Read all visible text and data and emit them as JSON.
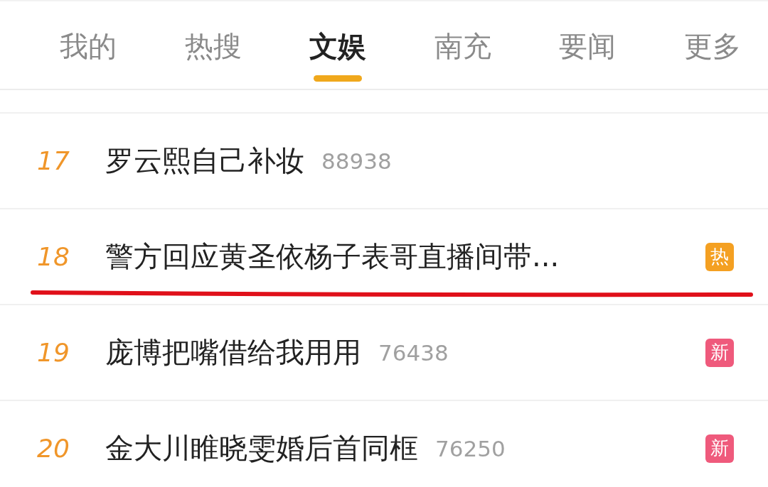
{
  "tabs": [
    {
      "label": "我的",
      "selected": false
    },
    {
      "label": "热搜",
      "selected": false
    },
    {
      "label": "文娱",
      "selected": true
    },
    {
      "label": "南充",
      "selected": false
    },
    {
      "label": "要闻",
      "selected": false
    },
    {
      "label": "更多",
      "selected": false
    }
  ],
  "rows": [
    {
      "rank": "17",
      "title": "罗云熙自己补妆",
      "count": "88938",
      "annotated": false
    },
    {
      "rank": "18",
      "title": "警方回应黄圣依杨子表哥直播间带...",
      "badge": {
        "label": "热",
        "color": "#f4a022"
      },
      "annotated": true
    },
    {
      "rank": "19",
      "title": "庞博把嘴借给我用用",
      "count": "76438",
      "badge": {
        "label": "新",
        "color": "#ef5a7c"
      },
      "annotated": false
    },
    {
      "rank": "20",
      "title": "金大川睢晓雯婚后首同框",
      "count": "76250",
      "badge": {
        "label": "新",
        "color": "#ef5a7c"
      },
      "annotated": false
    }
  ]
}
